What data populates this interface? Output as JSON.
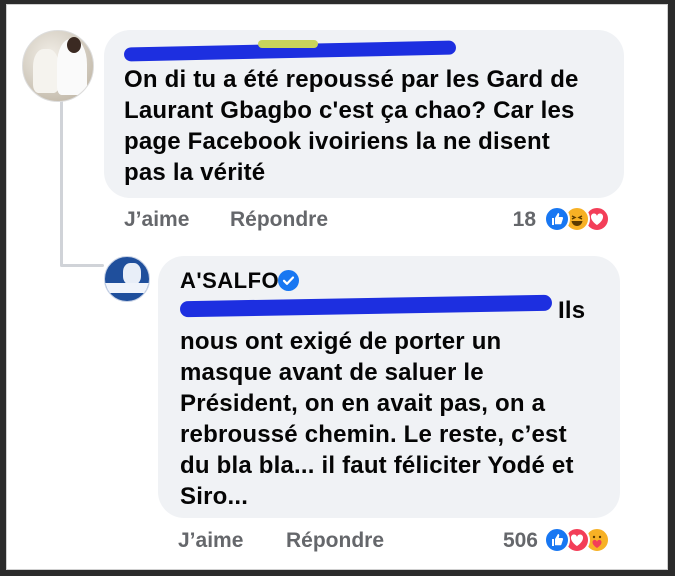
{
  "comment": {
    "text": "On di tu a été repoussé par les Gard de\nLaurant Gbagbo c'est ça chao? Car les\npage Facebook ivoiriens la ne disent\npas la vérité",
    "like_label": "J’aime",
    "reply_label": "Répondre",
    "reaction_count": "18",
    "reactions": [
      "like-icon",
      "haha-icon",
      "love-icon"
    ]
  },
  "reply": {
    "author": "A'SALFO",
    "verified": true,
    "text": "Ils\nnous ont exigé de porter un\nmasque avant de saluer le\nPrésident, on en avait pas, on a\nrebroussé chemin. Le reste, c’est\ndu bla bla... il faut féliciter Yodé et\nSiro...",
    "like_label": "J’aime",
    "reply_label": "Répondre",
    "reaction_count": "506",
    "reactions": [
      "like-icon",
      "love-icon",
      "care-icon"
    ]
  },
  "colors": {
    "bubble": "#f0f2f5",
    "meta_text": "#65676b",
    "like": "#1877f2",
    "love": "#f33e58",
    "haha": "#f7b125",
    "redaction": "#1d2fe0"
  }
}
